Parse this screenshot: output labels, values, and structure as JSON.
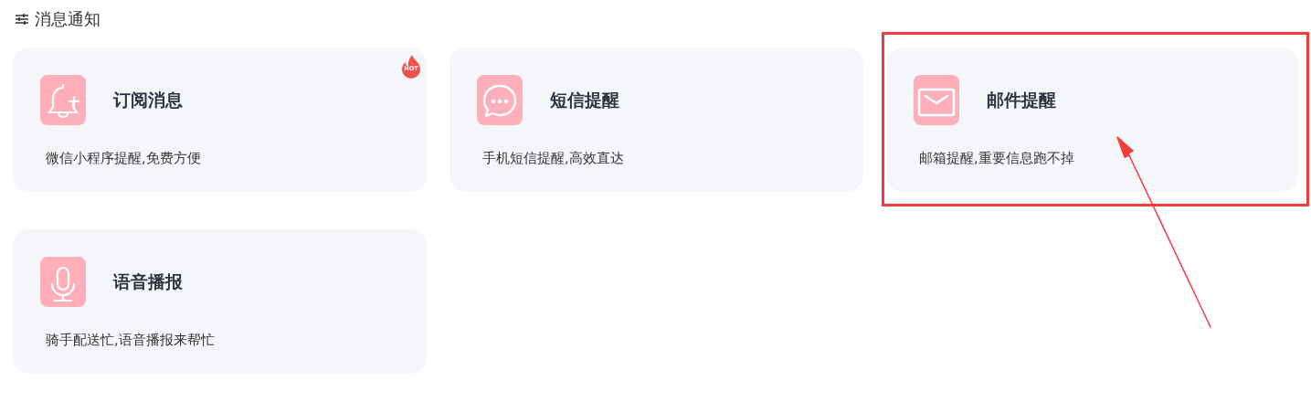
{
  "section": {
    "title": "消息通知"
  },
  "cards": [
    {
      "kind": "bell",
      "title": "订阅消息",
      "description": "微信小程序提醒,免费方便",
      "badge": "HOT",
      "highlighted": false
    },
    {
      "kind": "chat",
      "title": "短信提醒",
      "description": "手机短信提醒,高效直达",
      "highlighted": false
    },
    {
      "kind": "mail",
      "title": "邮件提醒",
      "description": "邮箱提醒,重要信息跑不掉",
      "highlighted": true
    },
    {
      "kind": "mic",
      "title": "语音播报",
      "description": "骑手配送忙,语音播报来帮忙",
      "highlighted": false
    }
  ]
}
